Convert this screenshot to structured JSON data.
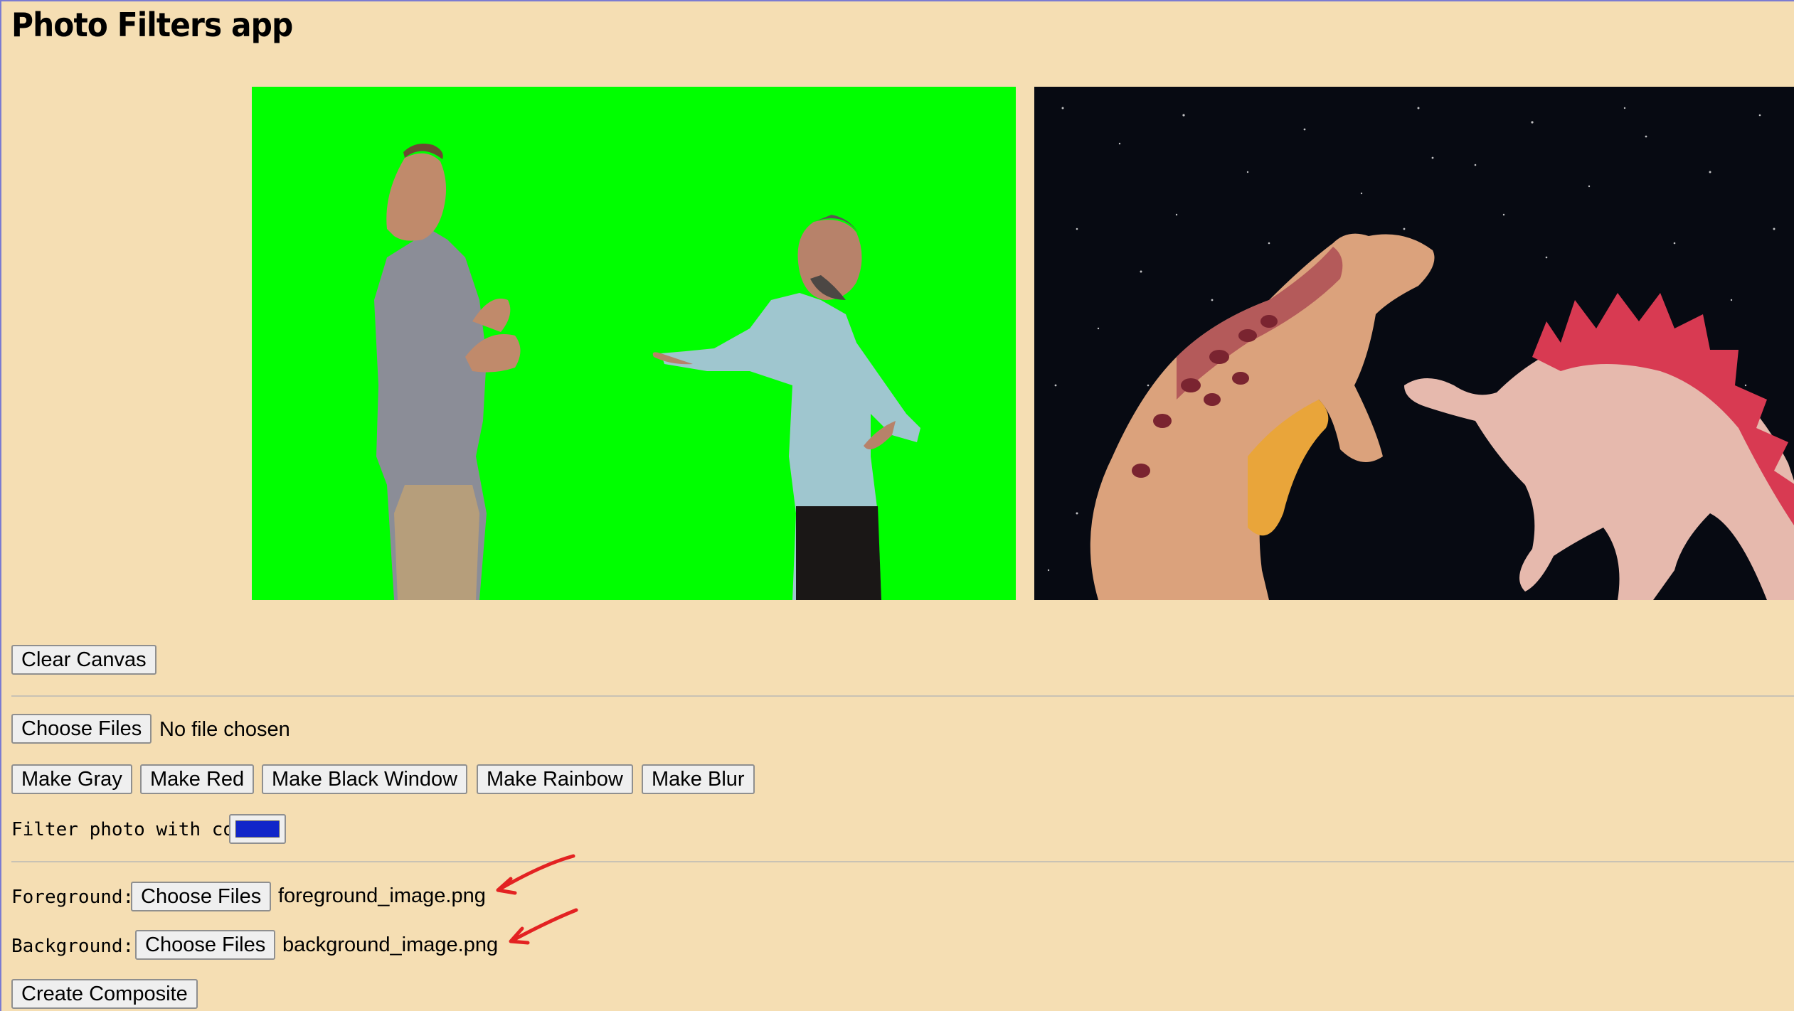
{
  "app": {
    "title": "Photo Filters app"
  },
  "canvases": {
    "foreground_bg_color": "#00ff00",
    "background_bg_color": "#070a12"
  },
  "controls": {
    "clear_canvas_label": "Clear Canvas",
    "file_input": {
      "button_label": "Choose Files",
      "status": "No file chosen"
    },
    "filters": [
      "Make Gray",
      "Make Red",
      "Make Black Window",
      "Make Rainbow",
      "Make Blur"
    ],
    "color_filter": {
      "label": "Filter photo with color:",
      "value": "#1126c9"
    }
  },
  "composite": {
    "foreground": {
      "label": "Foreground:",
      "button_label": "Choose Files",
      "file_name": "foreground_image.png"
    },
    "background": {
      "label": "Background:",
      "button_label": "Choose Files",
      "file_name": "background_image.png"
    },
    "create_label": "Create Composite"
  },
  "annotations": {
    "arrow_color": "#e32222"
  }
}
